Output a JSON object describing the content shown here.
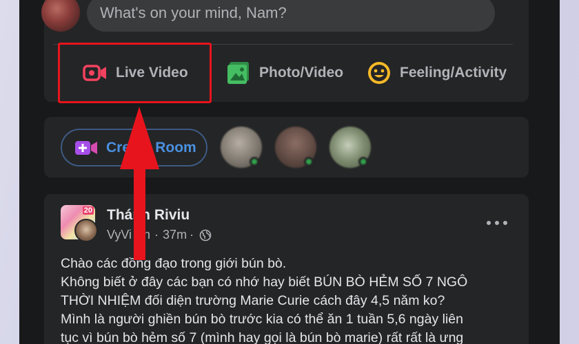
{
  "composer": {
    "placeholder": "What's on your mind, Nam?",
    "actions": [
      {
        "label": "Live Video",
        "icon": "live-video-icon",
        "color": "#f3425f"
      },
      {
        "label": "Photo/Video",
        "icon": "photo-video-icon",
        "color": "#45bd62"
      },
      {
        "label": "Feeling/Activity",
        "icon": "feeling-activity-icon",
        "color": "#f7b928"
      }
    ]
  },
  "rooms": {
    "create_label": "Create Room",
    "icon": "video-plus-icon",
    "friends_online": 3
  },
  "post": {
    "page_name": "Thánh Riviu",
    "author": "VyVi Ph",
    "time": "37m",
    "separator": "·",
    "privacy_icon": "globe-icon",
    "avatar_badge": "20",
    "lines": [
      "Chào các đồng đạo trong giới bún bò.",
      "Không biết ở đây các bạn có nhớ hay biết BÚN BÒ HẺM SỐ 7 NGÔ",
      "THỜI NHIỆM đối diện trường Marie Curie cách đây 4,5 năm ko?",
      "Mình là người ghiền bún bò trước kia có thể ăn 1 tuần 5,6 ngày liên",
      "tục vì bún bò hẻm số 7 (mình hay gọi là bún bò marie) rất rất là ưng"
    ]
  },
  "annotation": {
    "highlight_color": "#e8141d",
    "target": "Live Video"
  }
}
